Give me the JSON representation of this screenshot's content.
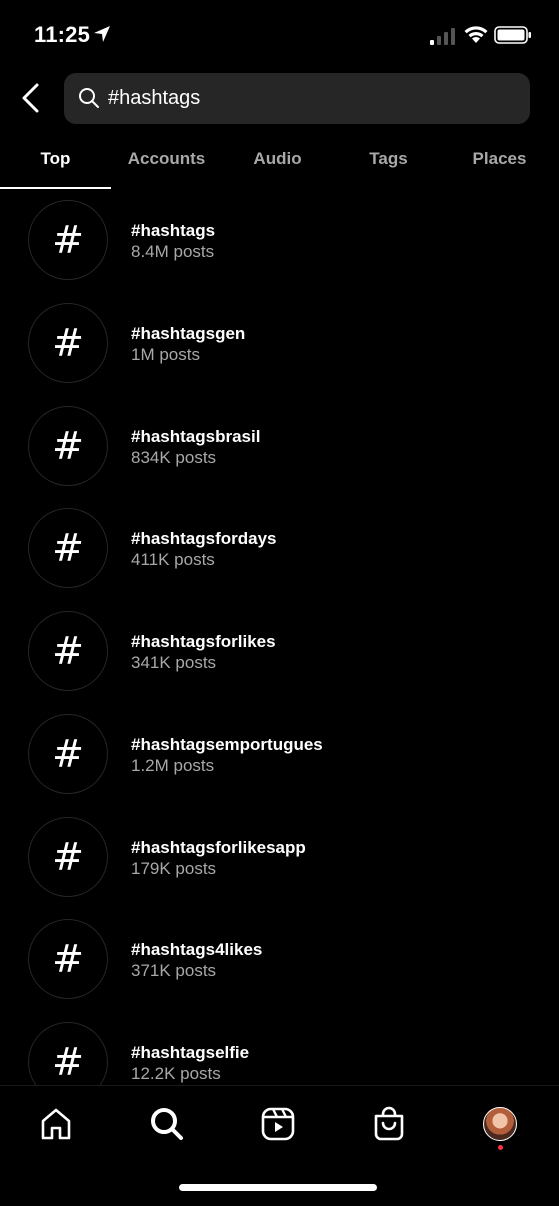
{
  "status_bar": {
    "time": "11:25",
    "icons": [
      "location-arrow-icon",
      "cellular-signal-icon",
      "wifi-icon",
      "battery-icon"
    ]
  },
  "search": {
    "query": "#hashtags",
    "placeholder": "Search"
  },
  "tabs": [
    {
      "label": "Top",
      "active": true
    },
    {
      "label": "Accounts",
      "active": false
    },
    {
      "label": "Audio",
      "active": false
    },
    {
      "label": "Tags",
      "active": false
    },
    {
      "label": "Places",
      "active": false
    }
  ],
  "results": [
    {
      "icon": "#",
      "name": "#hashtags",
      "count": "8.4M posts"
    },
    {
      "icon": "#",
      "name": "#hashtagsgen",
      "count": "1M posts"
    },
    {
      "icon": "#",
      "name": "#hashtagsbrasil",
      "count": "834K posts"
    },
    {
      "icon": "#",
      "name": "#hashtagsfordays",
      "count": "411K posts"
    },
    {
      "icon": "#",
      "name": "#hashtagsforlikes",
      "count": "341K posts"
    },
    {
      "icon": "#",
      "name": "#hashtagsemportugues",
      "count": "1.2M posts"
    },
    {
      "icon": "#",
      "name": "#hashtagsforlikesapp",
      "count": "179K posts"
    },
    {
      "icon": "#",
      "name": "#hashtags4likes",
      "count": "371K posts"
    },
    {
      "icon": "#",
      "name": "#hashtagselfie",
      "count": "12.2K posts"
    }
  ],
  "bottom_nav": {
    "items": [
      "home-icon",
      "search-icon",
      "reels-icon",
      "shop-icon",
      "profile-avatar"
    ],
    "active": "search-icon",
    "notification_dot_color": "#ff3040"
  },
  "colors": {
    "background": "#000000",
    "search_field": "#262626",
    "secondary_text": "#a8a8a8"
  }
}
